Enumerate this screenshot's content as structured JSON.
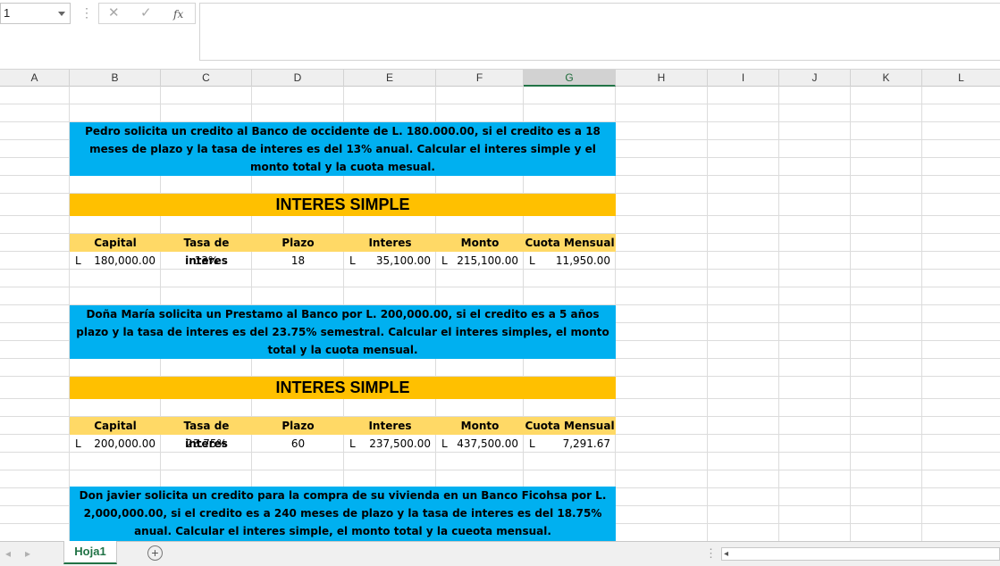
{
  "formula_bar": {
    "name_box": "1",
    "cancel_icon": "✕",
    "enter_icon": "✓",
    "fx_label": "fx",
    "formula": ""
  },
  "columns": [
    "A",
    "B",
    "C",
    "D",
    "E",
    "F",
    "G",
    "H",
    "I",
    "J",
    "K",
    "L"
  ],
  "selected_column": "G",
  "problems": [
    {
      "statement": "Pedro solicita un credito al Banco de occidente de L. 180.000.00, si el credito es a 18 meses de plazo y la tasa de interes es del 13% anual. Calcular el interes simple y el monto total y la cuota mesual.",
      "section_title": "INTERES SIMPLE",
      "headers": [
        "Capital",
        "Tasa de interes",
        "Plazo",
        "Interes",
        "Monto",
        "Cuota Mensual"
      ],
      "values": {
        "capital": "180,000.00",
        "tasa": "13%",
        "plazo": "18",
        "interes": "35,100.00",
        "monto": "215,100.00",
        "cuota": "11,950.00"
      }
    },
    {
      "statement": "Doña María solicita un Prestamo al Banco por L. 200,000.00, si el credito es a 5 años plazo y la tasa de interes es del 23.75% semestral. Calcular el interes simples, el monto total y la cuota mensual.",
      "section_title": "INTERES SIMPLE",
      "headers": [
        "Capital",
        "Tasa de interes",
        "Plazo",
        "Interes",
        "Monto",
        "Cuota Mensual"
      ],
      "values": {
        "capital": "200,000.00",
        "tasa": "23.75%",
        "plazo": "60",
        "interes": "237,500.00",
        "monto": "437,500.00",
        "cuota": "7,291.67"
      }
    },
    {
      "statement": "Don javier solicita un credito para la compra de su vivienda en un Banco Ficohsa por L. 2,000,000.00, si el credito es a 240 meses de plazo y la tasa de interes es del 18.75% anual. Calcular el interes simple, el monto total y la cueota mensual."
    }
  ],
  "currency": "L",
  "sheet_tab": "Hoja1",
  "colors": {
    "statement_bg": "#00b0f0",
    "title_bg": "#ffc000",
    "header_bg": "#ffd966",
    "excel_green": "#217346"
  }
}
